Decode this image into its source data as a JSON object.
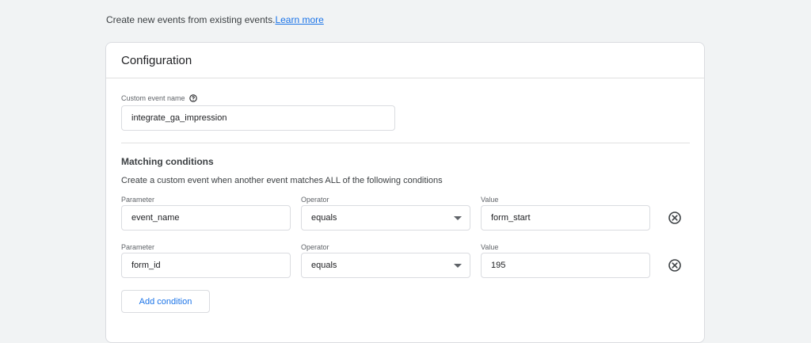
{
  "intro": {
    "text": "Create new events from existing events.",
    "link": "Learn more"
  },
  "card": {
    "title": "Configuration",
    "custom_event": {
      "label": "Custom event name",
      "value": "integrate_ga_impression",
      "help_icon": "help-circle-icon"
    },
    "matching": {
      "title": "Matching conditions",
      "description": "Create a custom event when another event matches ALL of the following conditions",
      "conditions": [
        {
          "parameter_label": "Parameter",
          "parameter": "event_name",
          "operator_label": "Operator",
          "operator": "equals",
          "value_label": "Value",
          "value": "form_start"
        },
        {
          "parameter_label": "Parameter",
          "parameter": "form_id",
          "operator_label": "Operator",
          "operator": "equals",
          "value_label": "Value",
          "value": "195"
        }
      ],
      "add_label": "Add condition"
    }
  },
  "colors": {
    "background": "#f1f3f4",
    "accent": "#1a73e8",
    "border": "#dadce0"
  }
}
